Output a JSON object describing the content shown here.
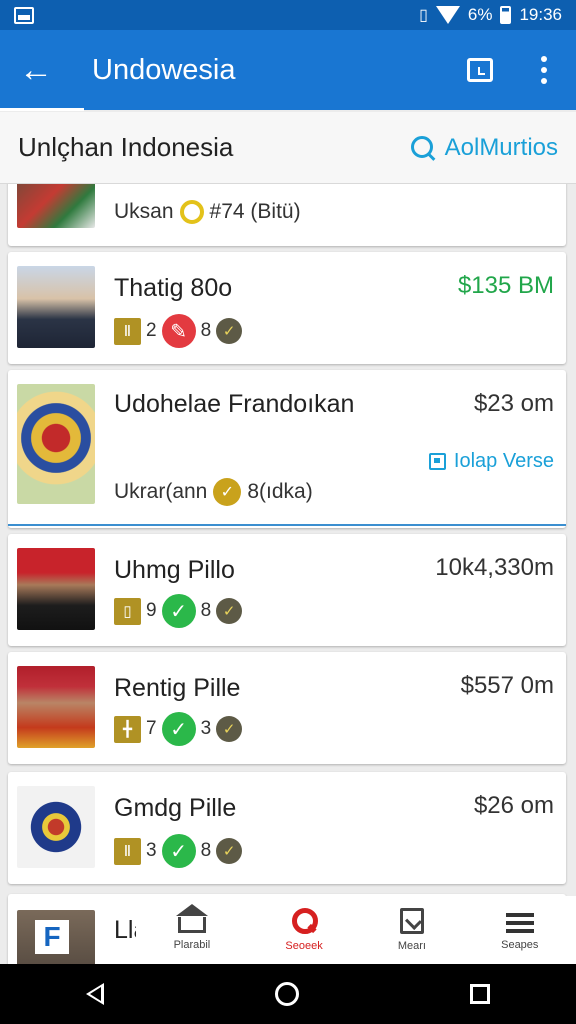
{
  "status_bar": {
    "battery": "6%",
    "time": "19:36"
  },
  "app_bar": {
    "title": "Undowesia"
  },
  "subheader": {
    "title": "Unlçhan Indonesia",
    "action_label": "AolMurtios"
  },
  "cards": [
    {
      "name": "",
      "price": "",
      "sub_text": "Uksan",
      "sub_extra": "#74 (Bitü)"
    },
    {
      "name": "Thatig 80o",
      "price": "$135 BM",
      "badge_a": "2",
      "badge_b": "8"
    },
    {
      "name": "Udohelae Frandoıkan",
      "price": "$23 om",
      "update_label": "Iolap Verse",
      "sub_text": "Ukrar(ann",
      "sub_extra": "8(ıdka)"
    },
    {
      "name": "Uhmg Pillo",
      "price": "10k4,330m",
      "badge_a": "9",
      "badge_b": "8"
    },
    {
      "name": "Rentig Pille",
      "price": "$557 0m",
      "badge_a": "7",
      "badge_b": "3"
    },
    {
      "name": "Gmdg Pille",
      "price": "$26 om",
      "badge_a": "3",
      "badge_b": "8"
    },
    {
      "name": "Llat",
      "price": ""
    }
  ],
  "bottom_nav": [
    {
      "label": "Plarabil"
    },
    {
      "label": "Seoeek"
    },
    {
      "label": "Mearı"
    },
    {
      "label": "Seapes"
    }
  ]
}
